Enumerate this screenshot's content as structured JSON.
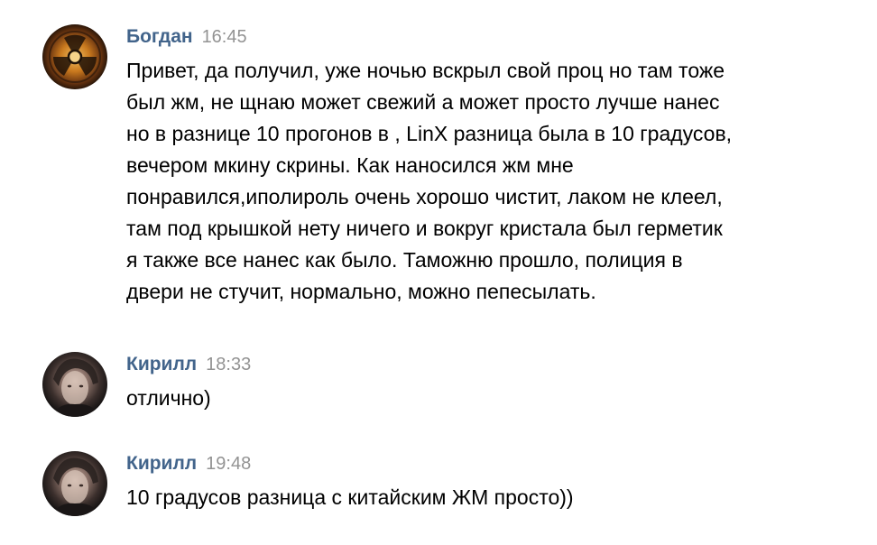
{
  "messages": [
    {
      "author": "Богдан",
      "time": "16:45",
      "avatar_icon": "radiation-symbol-avatar",
      "lines": [
        "Привет, да получил, уже ночью вскрыл свой проц но там тоже",
        "был жм, не щнаю может свежий а может просто лучше нанес",
        "но в разнице 10 прогонов в , LinX разница была в 10 градусов,",
        "вечером мкину скрины. Как наносился жм мне",
        "понравился,иполироль очень хорошо чистит, лаком не клеел,",
        "там под крышкой нету ничего и вокруг кристала был герметик",
        "я также все нанес как было. Таможню прошло, полиция в",
        "двери не стучит, нормально, можно пепесылать."
      ]
    },
    {
      "author": "Кирилл",
      "time": "18:33",
      "avatar_icon": "user-photo-avatar",
      "lines": [
        "отлично)"
      ]
    },
    {
      "author": "Кирилл",
      "time": "19:48",
      "avatar_icon": "user-photo-avatar",
      "lines": [
        "10 градусов разница с китайским ЖМ просто))"
      ]
    }
  ],
  "colors": {
    "author_name": "#42648b",
    "timestamp": "#939393",
    "message_text": "#000000",
    "background": "#ffffff"
  }
}
